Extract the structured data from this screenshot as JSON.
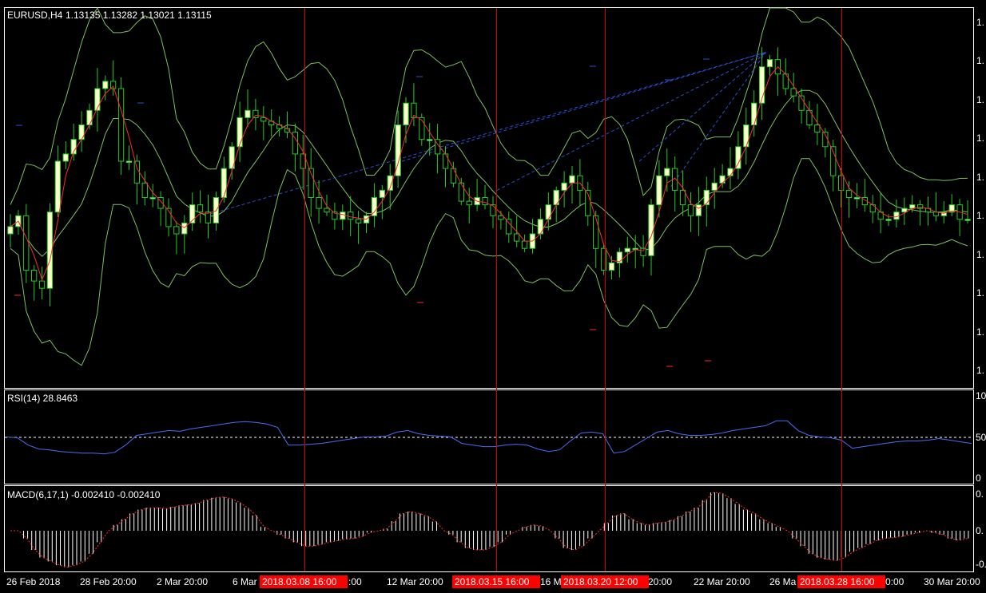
{
  "colors": {
    "background": "#000000",
    "border": "#ffffff",
    "bullish_candle": "#ffffcc",
    "bearish_candle": "#000000",
    "wick": "#22cc22",
    "bollinger": "#7fbf5a",
    "ma": "#ff2a2a",
    "vertical_marker": "#d00000",
    "tag_bg": "#ff0000",
    "rsi_line": "#4a6cf5",
    "macd_hist": "#ffffff",
    "macd_signal": "#ff2a2a",
    "trend_lines": "#2a4ecf"
  },
  "main_panel": {
    "title": "EURUSD,H4",
    "ohlc": "1.13135 1.13282 1.13021 1.13115",
    "price_axis_labels": [
      "1.",
      "1.",
      "1.",
      "1.",
      "1.",
      "1.",
      "1.",
      "1.",
      "1.",
      "1."
    ]
  },
  "rsi_panel": {
    "title": "RSI(14) 28.8463",
    "axis_labels": [
      "100",
      "50",
      "0"
    ]
  },
  "macd_panel": {
    "title": "MACD(6,17,1) -0.002410 -0.002410",
    "axis_labels": [
      "0.",
      "0.",
      "-0."
    ]
  },
  "time_axis": {
    "labels": [
      "26 Feb 2018",
      "28 Feb 20:00",
      "2 Mar 20:00",
      "6 Mar",
      ":00",
      "12 Mar 20:00",
      "16 M",
      "20:00",
      "22 Mar 20:00",
      "26 Ma",
      "0:00",
      "30 Mar 20:00"
    ],
    "highlighted": [
      "2018.03.08 16:00",
      "2018.03.15 16:00",
      "2018.03.20 12:00",
      "2018.03.28 16:00"
    ]
  },
  "chart_data": {
    "type": "candlestick",
    "symbol": "EURUSD",
    "timeframe": "H4",
    "close_path": [
      0.42,
      0.45,
      0.3,
      0.27,
      0.25,
      0.46,
      0.6,
      0.62,
      0.66,
      0.7,
      0.74,
      0.8,
      0.82,
      0.8,
      0.6,
      0.6,
      0.54,
      0.5,
      0.5,
      0.47,
      0.42,
      0.4,
      0.43,
      0.48,
      0.46,
      0.43,
      0.5,
      0.58,
      0.64,
      0.72,
      0.74,
      0.72,
      0.71,
      0.7,
      0.69,
      0.68,
      0.62,
      0.58,
      0.5,
      0.47,
      0.46,
      0.44,
      0.46,
      0.44,
      0.43,
      0.45,
      0.5,
      0.52,
      0.56,
      0.7,
      0.76,
      0.72,
      0.66,
      0.66,
      0.62,
      0.58,
      0.54,
      0.49,
      0.48,
      0.5,
      0.48,
      0.45,
      0.44,
      0.4,
      0.38,
      0.36,
      0.4,
      0.44,
      0.48,
      0.52,
      0.54,
      0.56,
      0.52,
      0.45,
      0.36,
      0.3,
      0.32,
      0.35,
      0.36,
      0.36,
      0.34,
      0.48,
      0.56,
      0.58,
      0.52,
      0.48,
      0.45,
      0.48,
      0.52,
      0.54,
      0.56,
      0.58,
      0.64,
      0.7,
      0.76,
      0.86,
      0.88,
      0.84,
      0.8,
      0.78,
      0.74,
      0.7,
      0.68,
      0.64,
      0.56,
      0.52,
      0.5,
      0.5,
      0.48,
      0.46,
      0.44,
      0.44,
      0.46,
      0.47,
      0.48,
      0.47,
      0.46,
      0.45,
      0.46,
      0.48,
      0.44,
      0.44
    ],
    "rsi_values": [
      50,
      49,
      40,
      35,
      34,
      32,
      31,
      30,
      30,
      29,
      31,
      40,
      52,
      54,
      56,
      58,
      57,
      60,
      62,
      64,
      66,
      68,
      69,
      68,
      66,
      62,
      40,
      40,
      41,
      42,
      44,
      46,
      48,
      50,
      50,
      51,
      56,
      58,
      54,
      52,
      51,
      50,
      42,
      40,
      38,
      38,
      40,
      41,
      40,
      35,
      32,
      34,
      45,
      55,
      56,
      54,
      30,
      32,
      40,
      48,
      56,
      58,
      54,
      52,
      52,
      53,
      55,
      58,
      60,
      62,
      64,
      70,
      70,
      58,
      52,
      50,
      49,
      46,
      36,
      38,
      40,
      42,
      44,
      45,
      45,
      46,
      48,
      46,
      44,
      42
    ],
    "rsi_levels": [
      100,
      50,
      0
    ],
    "macd_histogram": [
      0.0,
      0.0,
      -0.2,
      -0.5,
      -0.7,
      -0.8,
      -0.9,
      -0.95,
      -0.9,
      -0.8,
      -0.6,
      -0.3,
      0.0,
      0.15,
      0.3,
      0.45,
      0.55,
      0.6,
      0.6,
      0.58,
      0.62,
      0.66,
      0.68,
      0.72,
      0.8,
      0.86,
      0.88,
      0.84,
      0.74,
      0.6,
      0.4,
      0.1,
      0.0,
      -0.1,
      -0.2,
      -0.3,
      -0.4,
      -0.4,
      -0.36,
      -0.3,
      -0.26,
      -0.22,
      -0.2,
      -0.15,
      -0.05,
      0.0,
      0.05,
      0.25,
      0.45,
      0.5,
      0.45,
      0.38,
      0.24,
      0.0,
      -0.1,
      -0.3,
      -0.45,
      -0.5,
      -0.5,
      -0.42,
      -0.3,
      -0.1,
      0.0,
      0.1,
      0.15,
      0.12,
      0.0,
      -0.2,
      -0.45,
      -0.5,
      -0.4,
      -0.2,
      0.0,
      0.2,
      0.4,
      0.45,
      0.3,
      0.2,
      0.15,
      0.2,
      0.22,
      0.28,
      0.38,
      0.5,
      0.6,
      0.8,
      1.0,
      0.98,
      0.85,
      0.7,
      0.55,
      0.45,
      0.3,
      0.2,
      0.1,
      0.0,
      -0.2,
      -0.4,
      -0.6,
      -0.7,
      -0.75,
      -0.78,
      -0.7,
      -0.55,
      -0.45,
      -0.35,
      -0.25,
      -0.2,
      -0.18,
      -0.15,
      -0.1,
      -0.05,
      0.0,
      -0.05,
      -0.1,
      -0.2,
      -0.25,
      -0.2
    ]
  }
}
